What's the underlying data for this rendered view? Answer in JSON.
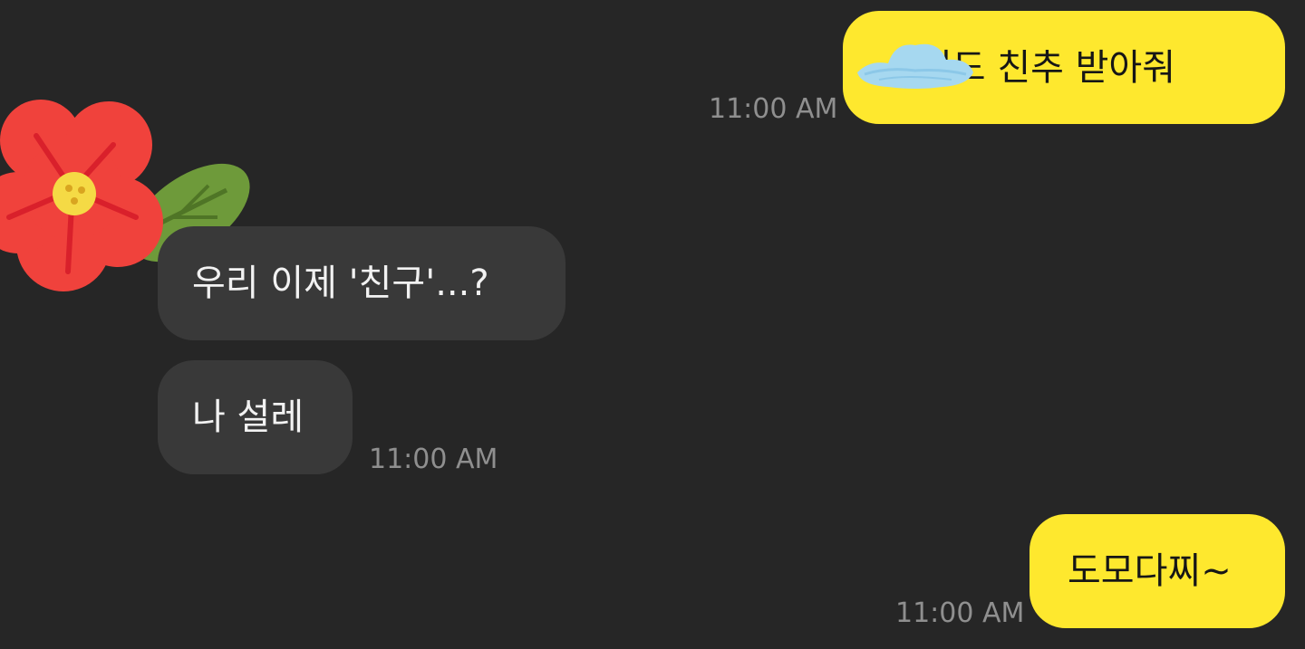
{
  "messages": [
    {
      "id": "sent1",
      "direction": "sent",
      "text": "이도 친추 받아줘",
      "time": "11:00 AM",
      "redacted_prefix": true
    },
    {
      "id": "recv1",
      "direction": "received",
      "text": "우리 이제 '친구'...?"
    },
    {
      "id": "recv2",
      "direction": "received",
      "text": "나 설레",
      "time": "11:00 AM"
    },
    {
      "id": "sent2",
      "direction": "sent",
      "text": "도모다찌~",
      "time": "11:00 AM"
    }
  ],
  "colors": {
    "background": "#262626",
    "sent_bubble": "#FEE82E",
    "received_bubble": "#393939",
    "timestamp": "#8f8f8f",
    "redaction_scribble": "#a6d8f0",
    "flower_petal": "#F0423C",
    "flower_leaf": "#6E9A3A",
    "flower_center": "#F5DA45"
  },
  "icons": {
    "avatar": "hibiscus-flower-sticker",
    "redaction": "blue-scribble-redaction"
  }
}
